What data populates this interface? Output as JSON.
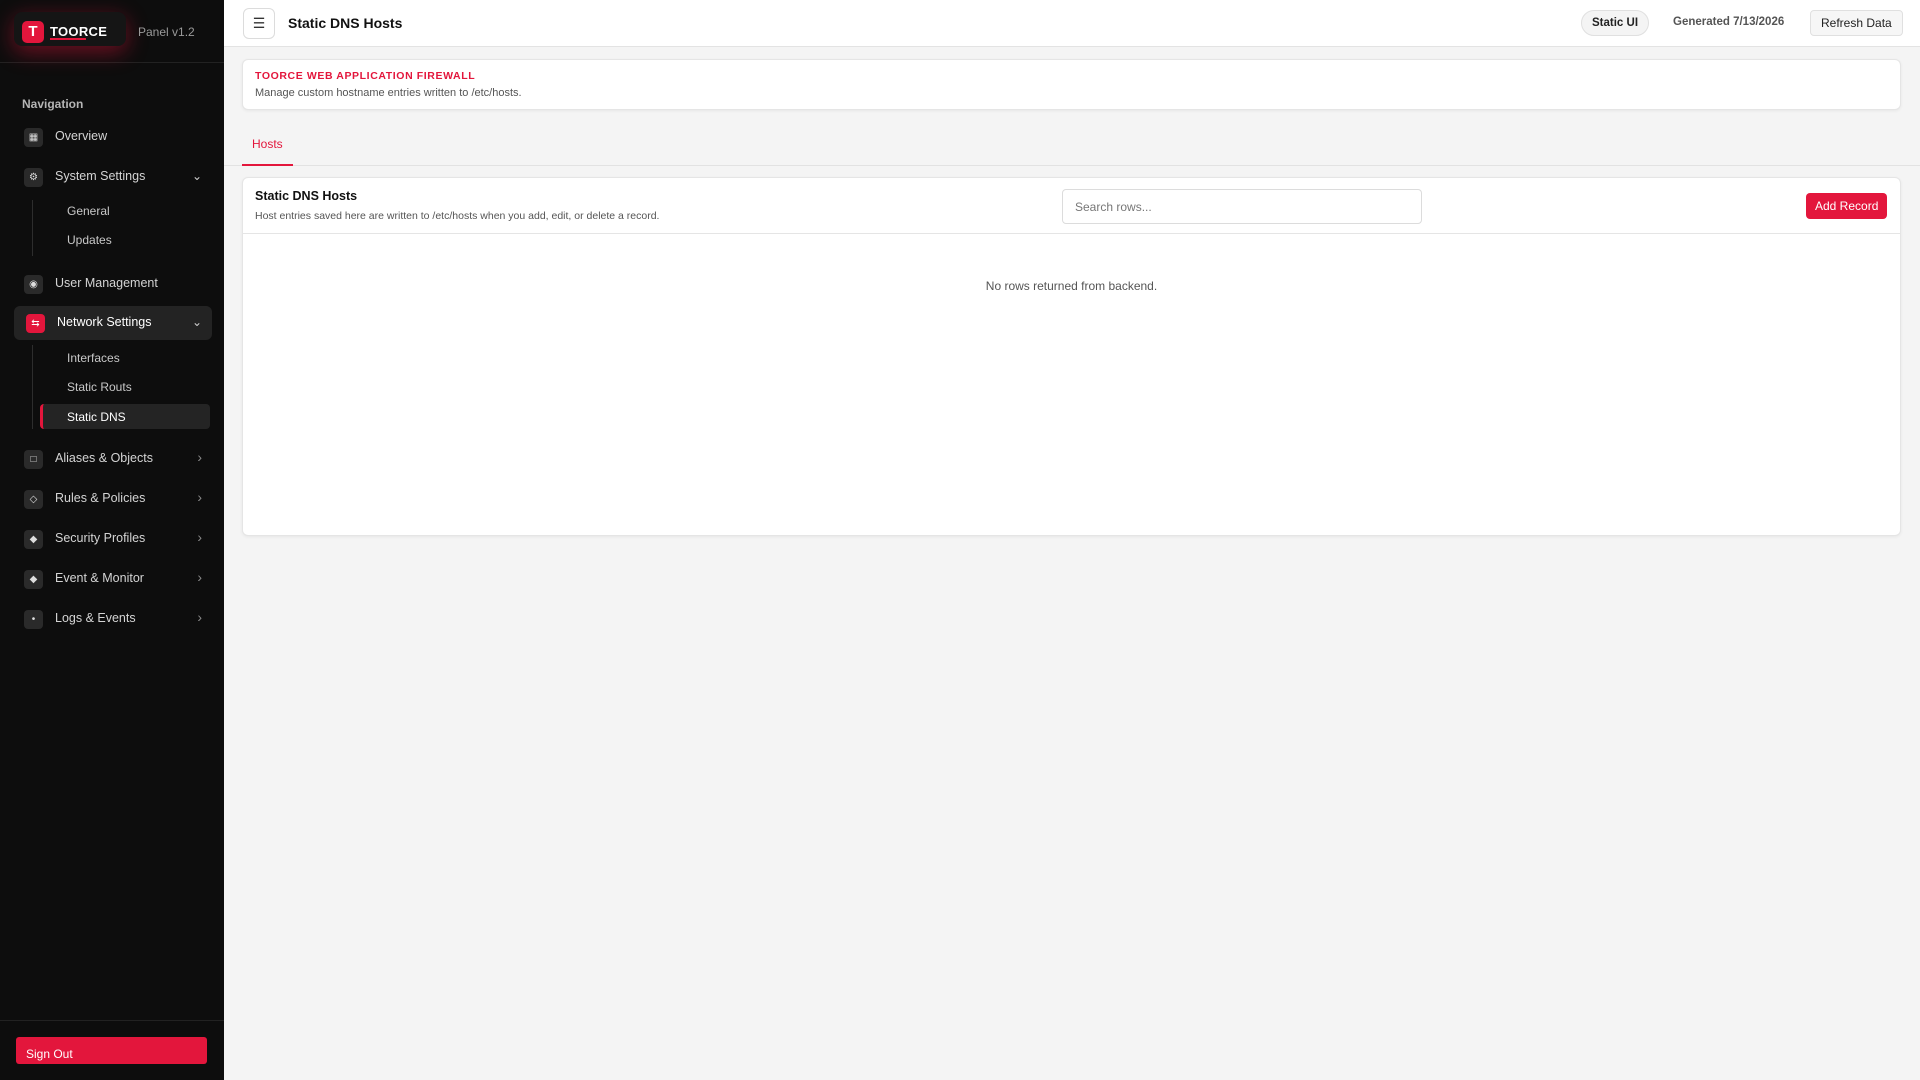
{
  "brand": {
    "logo_letter": "T",
    "name": "TOORCE",
    "version": "Panel v1.2"
  },
  "nav": {
    "heading": "Navigation",
    "items": [
      {
        "label": "Overview",
        "icon": "grid-icon"
      },
      {
        "label": "System Settings",
        "icon": "gear-icon",
        "expanded": true,
        "children": [
          {
            "label": "General"
          },
          {
            "label": "Updates"
          }
        ]
      },
      {
        "label": "User Management",
        "icon": "user-icon"
      },
      {
        "label": "Network Settings",
        "icon": "network-icon",
        "expanded": true,
        "active": true,
        "children": [
          {
            "label": "Interfaces"
          },
          {
            "label": "Static Routs"
          },
          {
            "label": "Static DNS",
            "active": true
          }
        ]
      },
      {
        "label": "Aliases & Objects",
        "icon": "square-icon"
      },
      {
        "label": "Rules & Policies",
        "icon": "diamond-outline-icon"
      },
      {
        "label": "Security Profiles",
        "icon": "diamond-icon"
      },
      {
        "label": "Event & Monitor",
        "icon": "diamond-filled-icon"
      },
      {
        "label": "Logs & Events",
        "icon": "dot-icon"
      }
    ],
    "signout": "Sign Out"
  },
  "header": {
    "menu_glyph": "☰",
    "title": "Static DNS Hosts",
    "mode_pill": "Static UI",
    "generated": "Generated 7/13/2026",
    "refresh": "Refresh Data"
  },
  "banner": {
    "title": "TOORCE WEB APPLICATION FIREWALL",
    "desc": "Manage custom hostname entries written to /etc/hosts."
  },
  "tabs": [
    {
      "label": "Hosts",
      "active": true
    }
  ],
  "card": {
    "title": "Static DNS Hosts",
    "desc": "Host entries saved here are written to /etc/hosts when you add, edit, or delete a record.",
    "search_placeholder": "Search rows...",
    "add_label": "Add Record",
    "empty": "No rows returned from backend."
  },
  "colors": {
    "accent": "#e3163c",
    "sidebar_bg": "#0d0d0d",
    "page_bg": "#f4f4f4"
  }
}
